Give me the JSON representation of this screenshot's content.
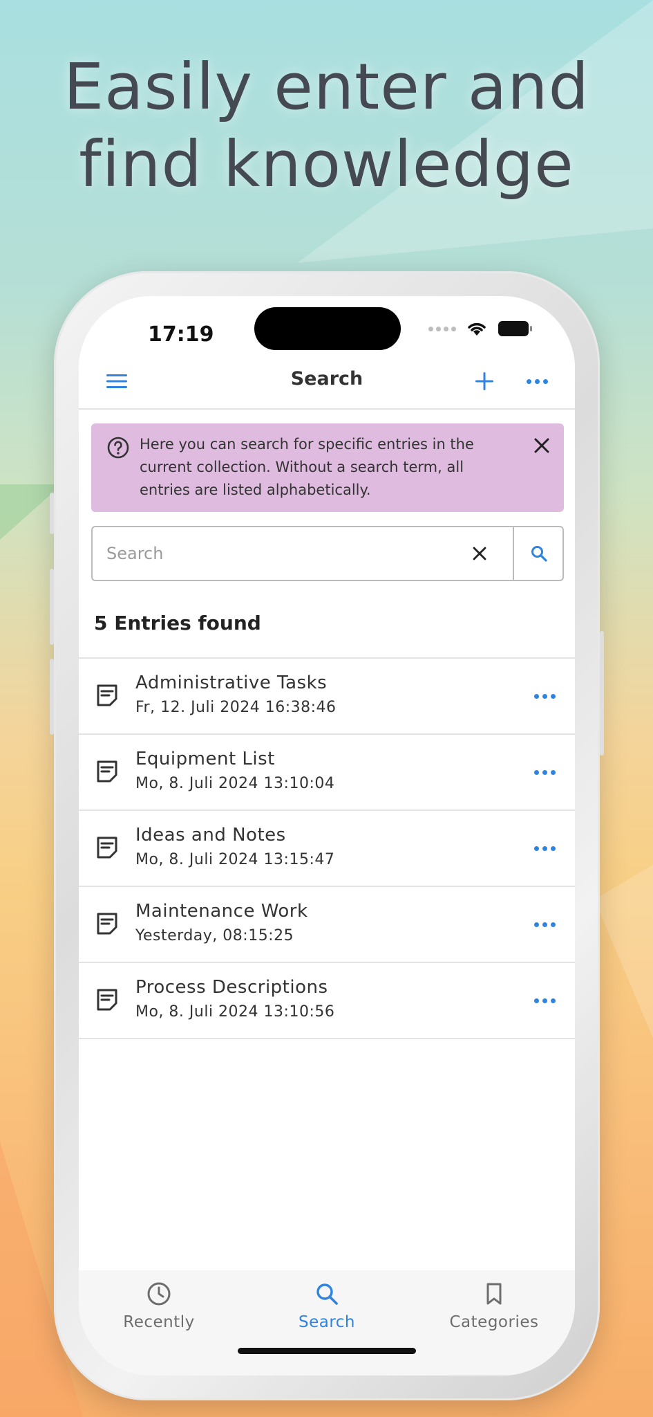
{
  "headline": {
    "line1": "Easily enter and",
    "line2": "find knowledge"
  },
  "status_bar": {
    "time": "17:19"
  },
  "navbar": {
    "title": "Search",
    "menu_icon": "hamburger-menu-icon",
    "add_icon": "plus-icon",
    "more_icon": "more-icon"
  },
  "info_banner": {
    "text": "Here you can search for specific entries in the current collection. Without a search term, all entries are listed alphabetically.",
    "background": "#dfbcdf"
  },
  "search": {
    "placeholder": "Search",
    "value": ""
  },
  "results": {
    "count_label": "5 Entries found",
    "items": [
      {
        "title": "Administrative Tasks",
        "date": "Fr, 12. Juli 2024 16:38:46"
      },
      {
        "title": "Equipment List",
        "date": "Mo, 8. Juli 2024 13:10:04"
      },
      {
        "title": "Ideas and Notes",
        "date": "Mo, 8. Juli 2024 13:15:47"
      },
      {
        "title": "Maintenance Work",
        "date": "Yesterday, 08:15:25"
      },
      {
        "title": "Process Descriptions",
        "date": "Mo, 8. Juli 2024 13:10:56"
      }
    ]
  },
  "tabbar": {
    "tabs": [
      {
        "label": "Recently",
        "icon": "clock-icon",
        "active": false
      },
      {
        "label": "Search",
        "icon": "search-icon",
        "active": true
      },
      {
        "label": "Categories",
        "icon": "bookmark-icon",
        "active": false
      }
    ]
  },
  "colors": {
    "accent": "#2f84e0",
    "inactive": "#6d6d6d",
    "text": "#333333"
  }
}
